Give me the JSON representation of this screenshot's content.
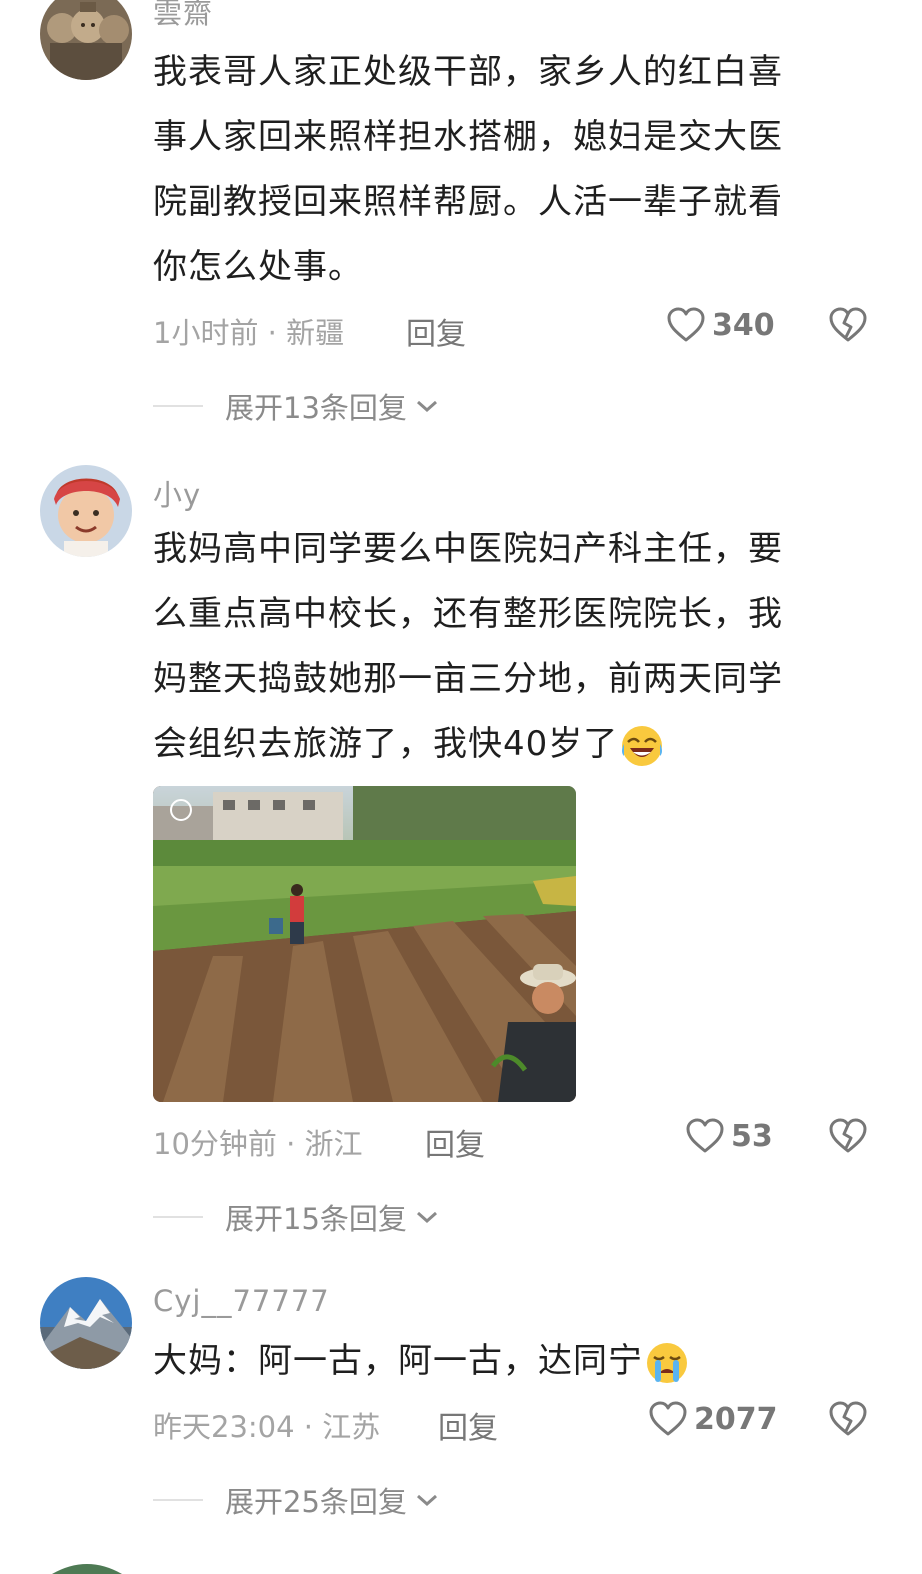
{
  "comments": [
    {
      "username": "雲齋",
      "text": "我表哥人家正处级干部，家乡人的红白喜事人家回来照样担水搭棚，媳妇是交大医院副教授回来照样帮厨。人活一辈子就看你怎么处事。",
      "lines": [
        "我表哥人家正处级干部，家乡人的红白喜",
        "事人家回来照样担水搭棚，媳妇是交大医",
        "院副教授回来照样帮厨。人活一辈子就看",
        "你怎么处事。"
      ],
      "meta": "1小时前 · 新疆",
      "reply_label": "回复",
      "likes": "340",
      "expand_label": "展开13条回复",
      "avatar_icon": "terracotta-warriors-avatar"
    },
    {
      "username": "小y",
      "lines": [
        "我妈高中同学要么中医院妇产科主任，要",
        "么重点高中校长，还有整形医院院长，我",
        "妈整天捣鼓她那一亩三分地，前两天同学",
        "会组织去旅游了，我快40岁了"
      ],
      "emoji": "laughing-crying-emoji",
      "image": "farmland-photo",
      "meta": "10分钟前 · 浙江",
      "reply_label": "回复",
      "likes": "53",
      "expand_label": "展开15条回复",
      "avatar_icon": "child-red-hat-avatar"
    },
    {
      "username": "Cyj__77777",
      "lines": [
        "大妈：阿一古，阿一古，达同宁"
      ],
      "emoji": "crying-emoji",
      "meta": "昨天23:04 · 江苏",
      "reply_label": "回复",
      "likes": "2077",
      "expand_label": "展开25条回复",
      "avatar_icon": "snow-mountain-avatar"
    }
  ],
  "colors": {
    "text": "#1f1f1f",
    "meta": "#a4a4a4",
    "muted": "#8a8a8a",
    "background": "#ffffff"
  }
}
